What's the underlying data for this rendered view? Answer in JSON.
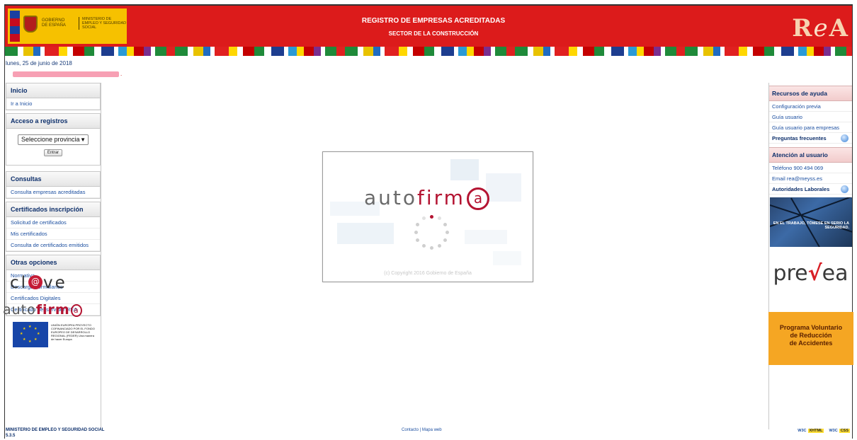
{
  "header": {
    "gov_name": "GOBIERNO DE ESPAÑA",
    "ministry": "MINISTERIO DE EMPLEO Y SEGURIDAD SOCIAL",
    "title": "REGISTRO DE EMPRESAS ACREDITADAS",
    "subtitle": "SECTOR DE LA CONSTRUCCIÓN",
    "logo_text": "REA"
  },
  "date": "lunes, 25 de junio de 2018",
  "left": {
    "inicio": {
      "title": "Inicio",
      "items": [
        "Ir a Inicio"
      ]
    },
    "acceso": {
      "title": "Acceso a registros",
      "select_value": "Seleccione provincia",
      "enter_label": "Entrar"
    },
    "consultas": {
      "title": "Consultas",
      "items": [
        "Consulta empresas acreditadas"
      ]
    },
    "certificados": {
      "title": "Certificados inscripción",
      "items": [
        "Solicitud de certificados",
        "Mis certificados",
        "Consulta de certificados emitidos"
      ]
    },
    "otras": {
      "title": "Otras opciones",
      "items": [
        "Normativa",
        "Descarga Formularios",
        "Certificados Digitales",
        "Certificado del servidor REA"
      ]
    },
    "eu_text": "UNIÓN EUROPEA PROYECTO COFINANCIADO POR EL FONDO EUROPEO DE DESARROLLO REGIONAL (FEDER) Una manera de hacer Europa",
    "clave_a": "cl",
    "clave_b": "ve",
    "autofirma_a": "auto",
    "autofirma_b": "firm"
  },
  "right": {
    "ayuda": {
      "title": "Recursos de ayuda",
      "items": [
        "Configuración previa",
        "Guía usuario",
        "Guía usuario para empresas"
      ],
      "strong_item": "Preguntas frecuentes"
    },
    "atencion": {
      "title": "Atención al usuario",
      "items": [
        "Teléfono 900 494 069",
        "Email rea@meyss.es"
      ],
      "strong_item": "Autoridades Laborales"
    },
    "banner_work_text": "EN EL TRABAJO, TÓMESE EN SERIO LA SEGURIDAD.",
    "prevea_a": "pre",
    "prevea_b": "ea",
    "programa": [
      "Programa Voluntario",
      "de Reducción",
      "de Accidentes"
    ]
  },
  "modal": {
    "brand_a": "auto",
    "brand_b": "firm",
    "copyright": "(c) Copyright 2016 Gobierno de España"
  },
  "footer": {
    "ministry": "MINISTERIO DE EMPLEO Y SEGURIDAD SOCIAL",
    "version": "5.3.5",
    "contact": "Contacto",
    "map": "Mapa web",
    "w3c_1": "XHTML",
    "w3c_2": "CSS"
  }
}
